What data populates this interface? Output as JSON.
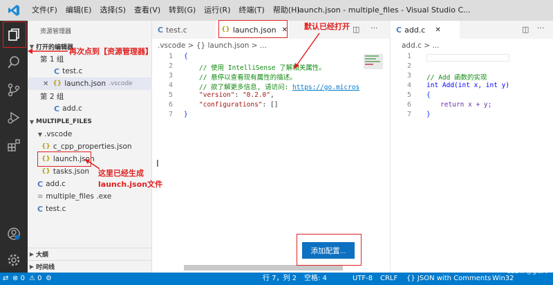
{
  "titlebar": {
    "menus": [
      "文件(F)",
      "编辑(E)",
      "选择(S)",
      "查看(V)",
      "转到(G)",
      "运行(R)",
      "终端(T)",
      "帮助(H)"
    ],
    "window_title": "launch.json - multiple_files - Visual Studio C..."
  },
  "sidebar": {
    "header": "资源管理器",
    "open_editors": {
      "title": "打开的编辑器",
      "group1": "第 1 组",
      "g1_file1": "test.c",
      "g1_file2": "launch.json",
      "g1_file2_dir": ".vscode",
      "group2": "第 2 组",
      "g2_file1": "add.c"
    },
    "folder": {
      "title": "MULTIPLE_FILES",
      "vscode_dir": ".vscode",
      "files": [
        "c_cpp_properties.json",
        "launch.json",
        "tasks.json"
      ],
      "add_c": "add.c",
      "exe": "multiple_files .exe",
      "test_c": "test.c"
    },
    "outline": "大纲",
    "timeline": "时间线"
  },
  "editor1": {
    "tab_test": "test.c",
    "tab_launch": "launch.json",
    "breadcrumb": ".vscode > {} launch.json > ...",
    "lines": [
      "1",
      "2",
      "3",
      "4",
      "5",
      "6",
      "7"
    ],
    "code": {
      "l1": "{",
      "l2": "// 使用 IntelliSense 了解相关属性。",
      "l3": "// 悬停以查看现有属性的描述。",
      "l4_prefix": "// 欲了解更多信息, 请访问: ",
      "l4_link": "https://go.microso",
      "l5_key": "\"version\"",
      "l5_val": "\"0.2.0\"",
      "l6_key": "\"configurations\"",
      "l6_val": "[]",
      "l7": "}"
    },
    "add_config_button": "添加配置..."
  },
  "editor2": {
    "tab": "add.c",
    "breadcrumb": "add.c > ...",
    "lines": [
      "1",
      "2",
      "3",
      "4",
      "5",
      "6",
      "7"
    ],
    "code": {
      "l3": "// Add 函数的实现",
      "l4": "int Add(int x, int y)",
      "l5": "{",
      "l6": "return x + y;",
      "l7": "}"
    }
  },
  "statusbar": {
    "errors": "0",
    "warnings": "0",
    "position": "行 7，列 2",
    "spaces": "空格: 4",
    "encoding": "UTF-8",
    "eol": "CRLF",
    "language": "{} JSON with Comments",
    "platform": "Win32"
  },
  "annotations": {
    "explorer_note": "再次点到【资源管理器】",
    "open_note": "默认已经打开",
    "generated_note_1": "这里已经生成",
    "generated_note_2": "launch.json文件"
  },
  "watermark": "CSDN @gis人",
  "colors": {
    "accent": "#007acc",
    "annotation_red": "#e02020",
    "activitybar": "#2c2c2c",
    "button": "#0e70c0"
  }
}
